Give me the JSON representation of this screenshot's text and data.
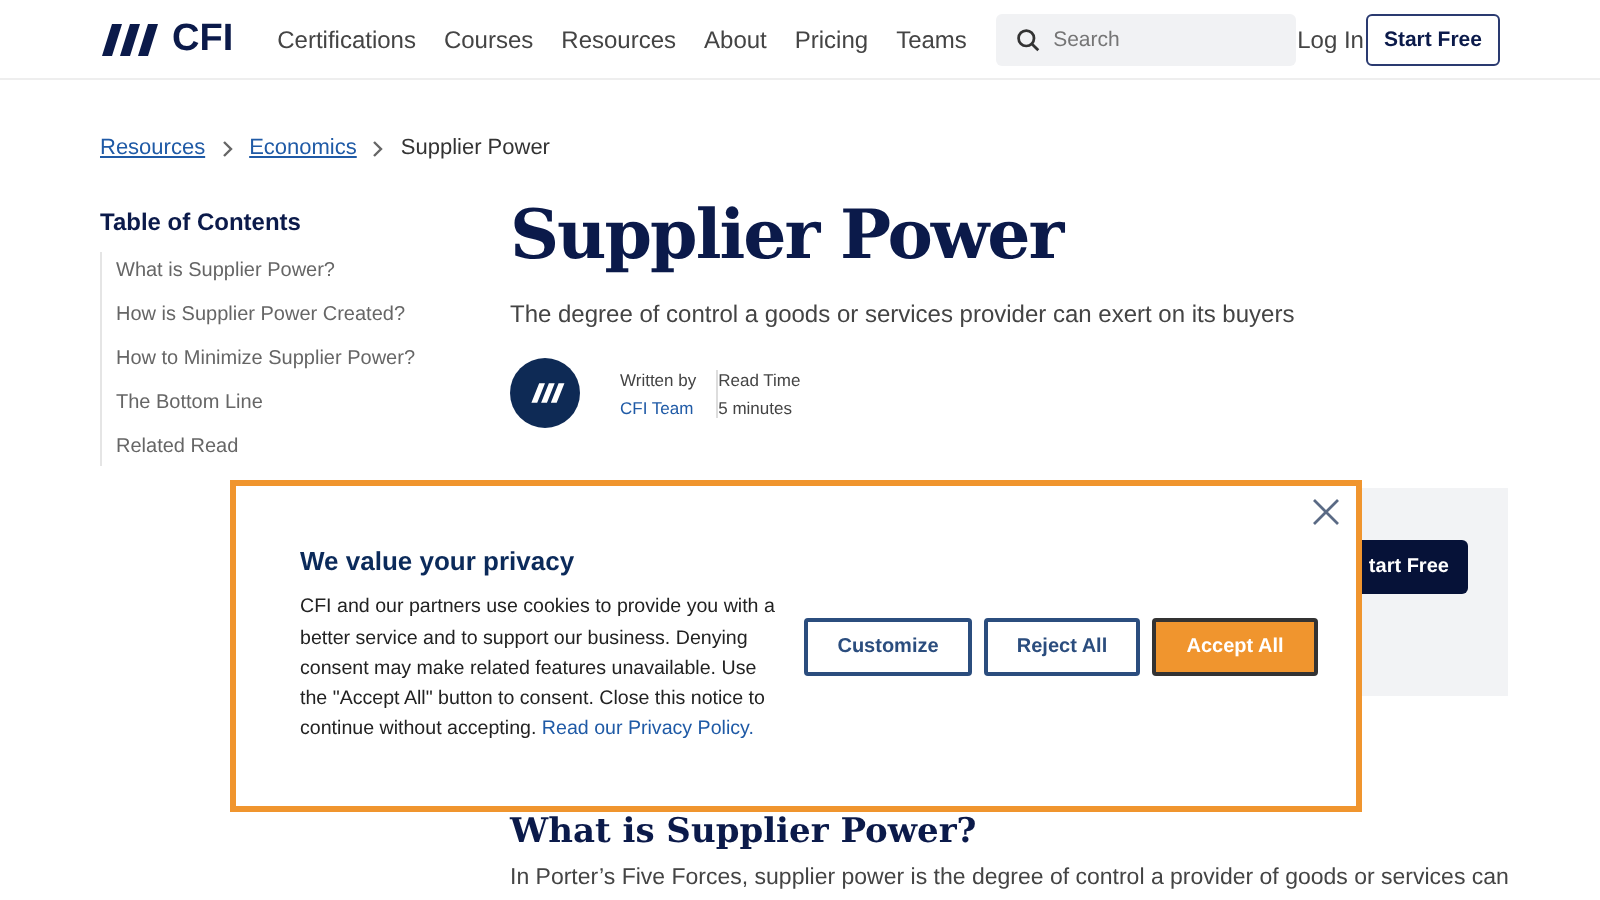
{
  "header": {
    "logo": "CFI",
    "nav": [
      "Certifications",
      "Courses",
      "Resources",
      "About",
      "Pricing",
      "Teams"
    ],
    "search": {
      "placeholder": "Search"
    },
    "login": "Log In",
    "start": "Start Free"
  },
  "breadcrumbs": [
    {
      "label": "Resources",
      "link": true
    },
    {
      "label": "Economics",
      "link": true
    },
    {
      "label": "Supplier Power",
      "link": false
    }
  ],
  "toc": {
    "title": "Table of Contents",
    "items": [
      "What is Supplier Power?",
      "How is Supplier Power Created?",
      "How to Minimize Supplier Power?",
      "The Bottom Line",
      "Related Read"
    ]
  },
  "article": {
    "title": "Supplier Power",
    "subtitle": "The degree of control a goods or services provider can exert on its buyers",
    "written_by_label": "Written by",
    "author": "CFI Team",
    "read_time_label": "Read Time",
    "read_time": "5 minutes",
    "promo_button": "tart Free",
    "heading": "What is Supplier Power?",
    "paragraph": "In Porter’s Five Forces, supplier power is the degree of control a provider of goods or services can"
  },
  "cookie": {
    "title": "We value your privacy",
    "text": "CFI and our partners use cookies to provide you with a better service and to support our business. Denying consent may make related features unavailable. Use the \"Accept All\" button to consent. Close this notice to continue without accepting.",
    "link": "Read our Privacy Policy.",
    "buttons": [
      {
        "label": "Customize",
        "kind": "outline"
      },
      {
        "label": "Reject All",
        "kind": "outline"
      },
      {
        "label": "Accept All",
        "kind": "primary"
      }
    ]
  }
}
